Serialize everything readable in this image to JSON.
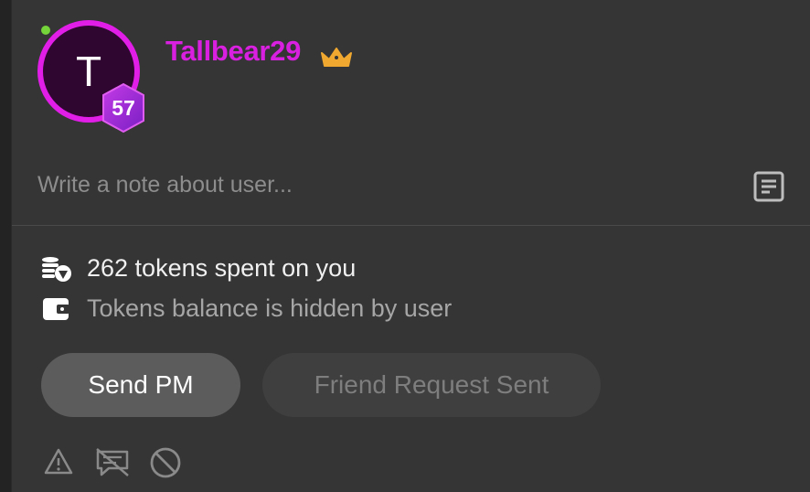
{
  "profile": {
    "avatar_letter": "T",
    "level": "57",
    "username": "Tallbear29",
    "online": true,
    "colors": {
      "accent": "#d91fe0",
      "crown": "#f0a830",
      "online": "#74d43a",
      "level_badge": "#9b2bd6"
    }
  },
  "note": {
    "placeholder": "Write a note about user...",
    "value": ""
  },
  "stats": {
    "tokens_spent": "262 tokens spent on you",
    "balance": "Tokens balance is hidden by user"
  },
  "actions": {
    "send_pm": "Send PM",
    "friend_request": "Friend Request Sent"
  },
  "footer_icons": [
    "report-warning-icon",
    "mute-messages-icon",
    "block-icon"
  ]
}
